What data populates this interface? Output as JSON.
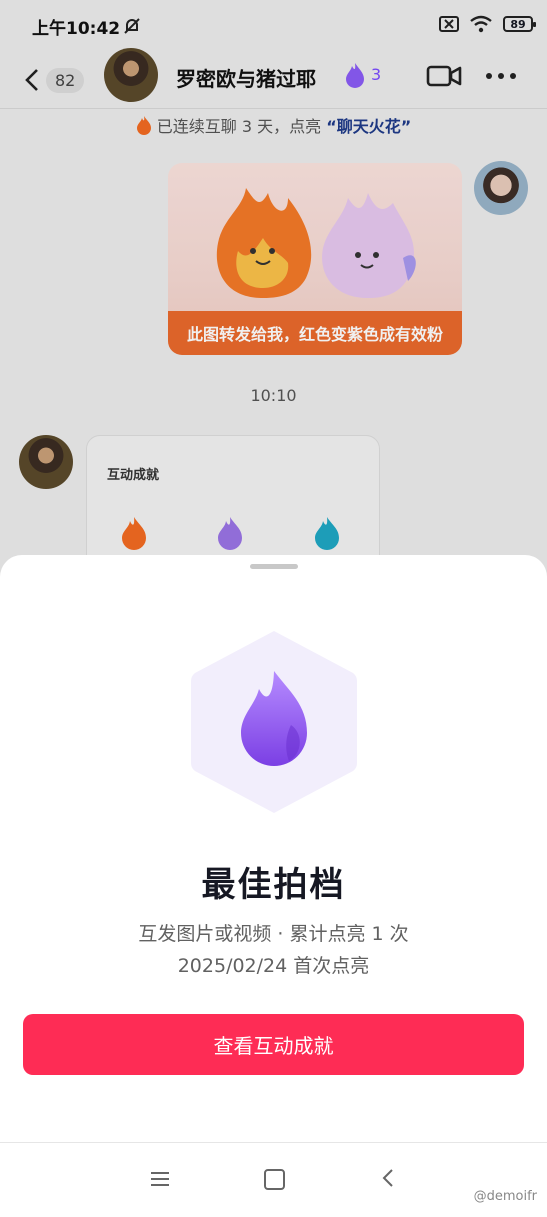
{
  "status": {
    "time": "上午10:42",
    "battery": "89"
  },
  "header": {
    "unread": "82",
    "name": "罗密欧与猪过耶",
    "spark_count": "3"
  },
  "streak": {
    "text": "已连续互聊 3 天，点亮",
    "highlight": "“聊天火花”"
  },
  "messages": {
    "image_caption": "此图转发给我，红色变紫色成有效粉",
    "time": "10:10",
    "card_title": "互动成就"
  },
  "sheet": {
    "title": "最佳拍档",
    "desc": "互发图片或视频 · 累计点亮 1 次",
    "date": "2025/02/24 首次点亮",
    "cta": "查看互动成就"
  },
  "watermark": "@demoifr",
  "colors": {
    "accent": "#fe2c55",
    "purple": "#8b5cf6",
    "orange": "#f36b21",
    "teal": "#1fa7c4"
  }
}
